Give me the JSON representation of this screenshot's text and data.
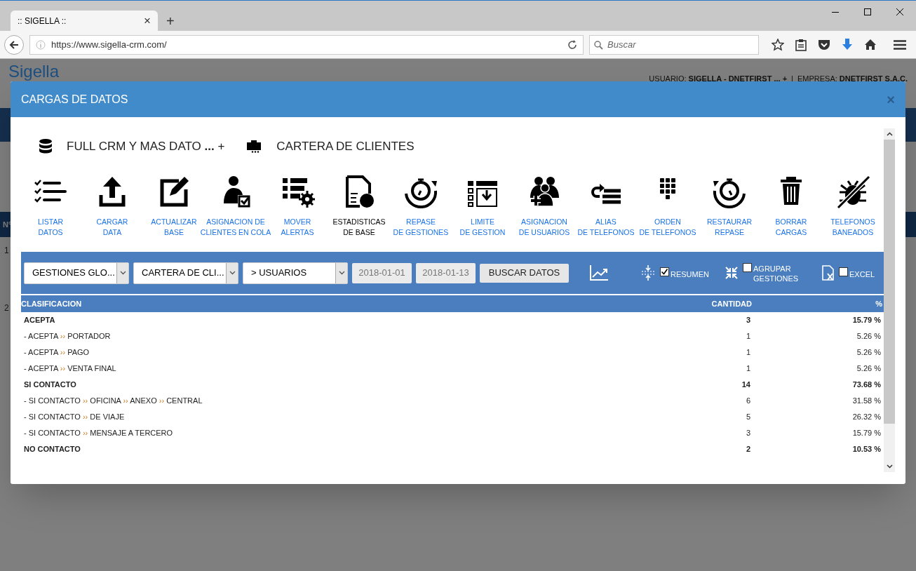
{
  "browser": {
    "tab_title": ":: SIGELLA ::",
    "tab_close": "×",
    "new_tab": "+",
    "url": "https://www.sigella-crm.com/",
    "search_placeholder": "Buscar"
  },
  "background": {
    "logo": "Sigella",
    "user": "USUARIO: **SIGELLA - DNETFIRST ... +**",
    "separator": "|",
    "company": "EMPRESA: **DNETFIRST S.A.C.**",
    "table_header": "N°",
    "rows": [
      "1",
      "2"
    ]
  },
  "modal": {
    "title": "CARGAS DE DATOS",
    "close": "×",
    "context": [
      {
        "label": "FULL CRM Y MAS DATO **...** +"
      },
      {
        "label": "CARTERA DE CLIENTES"
      }
    ],
    "tools": [
      {
        "lines": [
          "LISTAR",
          "DATOS"
        ],
        "selected": false
      },
      {
        "lines": [
          "CARGAR",
          "DATA"
        ],
        "selected": false
      },
      {
        "lines": [
          "ACTUALIZAR",
          "BASE"
        ],
        "selected": false
      },
      {
        "lines": [
          "ASIGNACION DE",
          "CLIENTES EN COLA"
        ],
        "selected": false
      },
      {
        "lines": [
          "MOVER",
          "ALERTAS"
        ],
        "selected": false
      },
      {
        "lines": [
          "ESTADISTICAS",
          "DE BASE"
        ],
        "selected": true
      },
      {
        "lines": [
          "REPASE",
          "DE GESTIONES"
        ],
        "selected": false
      },
      {
        "lines": [
          "LIMITE",
          "DE GESTION"
        ],
        "selected": false
      },
      {
        "lines": [
          "ASIGNACION",
          "DE USUARIOS"
        ],
        "selected": false
      },
      {
        "lines": [
          "ALIAS",
          "DE TELEFONOS"
        ],
        "selected": false
      },
      {
        "lines": [
          "ORDEN",
          "DE TELEFONOS"
        ],
        "selected": false
      },
      {
        "lines": [
          "RESTAURAR",
          "REPASE"
        ],
        "selected": false
      },
      {
        "lines": [
          "BORRAR",
          "CARGAS"
        ],
        "selected": false
      },
      {
        "lines": [
          "TELEFONOS",
          "BANEADOS"
        ],
        "selected": false
      }
    ],
    "filters": {
      "selects": [
        {
          "value": "GESTIONES GLO..."
        },
        {
          "value": "CARTERA DE CLI..."
        },
        {
          "value": "> USUARIOS"
        }
      ],
      "dates": [
        {
          "value": "2018-01-01"
        },
        {
          "value": "2018-01-13"
        }
      ],
      "button": "BUSCAR DATOS",
      "options": [
        {
          "label": "RESUMEN",
          "checked": true
        },
        {
          "label": "AGRUPAR GESTIONES",
          "checked": false
        },
        {
          "label": "EXCEL",
          "checked": false
        }
      ]
    },
    "table": {
      "columns": [
        "CLASIFICACION",
        "CANTIDAD",
        "%"
      ],
      "separator": "››",
      "rows": [
        {
          "kind": "group",
          "parts": [
            "ACEPTA"
          ],
          "count": "3",
          "percent": "15.79 %"
        },
        {
          "kind": "item",
          "parts": [
            "- ACEPTA",
            "PORTADOR"
          ],
          "count": "1",
          "percent": "5.26 %"
        },
        {
          "kind": "item",
          "parts": [
            "- ACEPTA",
            "PAGO"
          ],
          "count": "1",
          "percent": "5.26 %"
        },
        {
          "kind": "item",
          "parts": [
            "- ACEPTA",
            "VENTA FINAL"
          ],
          "count": "1",
          "percent": "5.26 %"
        },
        {
          "kind": "group",
          "parts": [
            "SI CONTACTO"
          ],
          "count": "14",
          "percent": "73.68 %"
        },
        {
          "kind": "item",
          "parts": [
            "- SI CONTACTO",
            "OFICINA",
            "ANEXO",
            "CENTRAL"
          ],
          "count": "6",
          "percent": "31.58 %"
        },
        {
          "kind": "item",
          "parts": [
            "- SI CONTACTO",
            "DE VIAJE"
          ],
          "count": "5",
          "percent": "26.32 %"
        },
        {
          "kind": "item",
          "parts": [
            "- SI CONTACTO",
            "MENSAJE A TERCERO"
          ],
          "count": "3",
          "percent": "15.79 %"
        },
        {
          "kind": "group",
          "parts": [
            "NO CONTACTO"
          ],
          "count": "2",
          "percent": "10.53 %"
        }
      ]
    }
  }
}
